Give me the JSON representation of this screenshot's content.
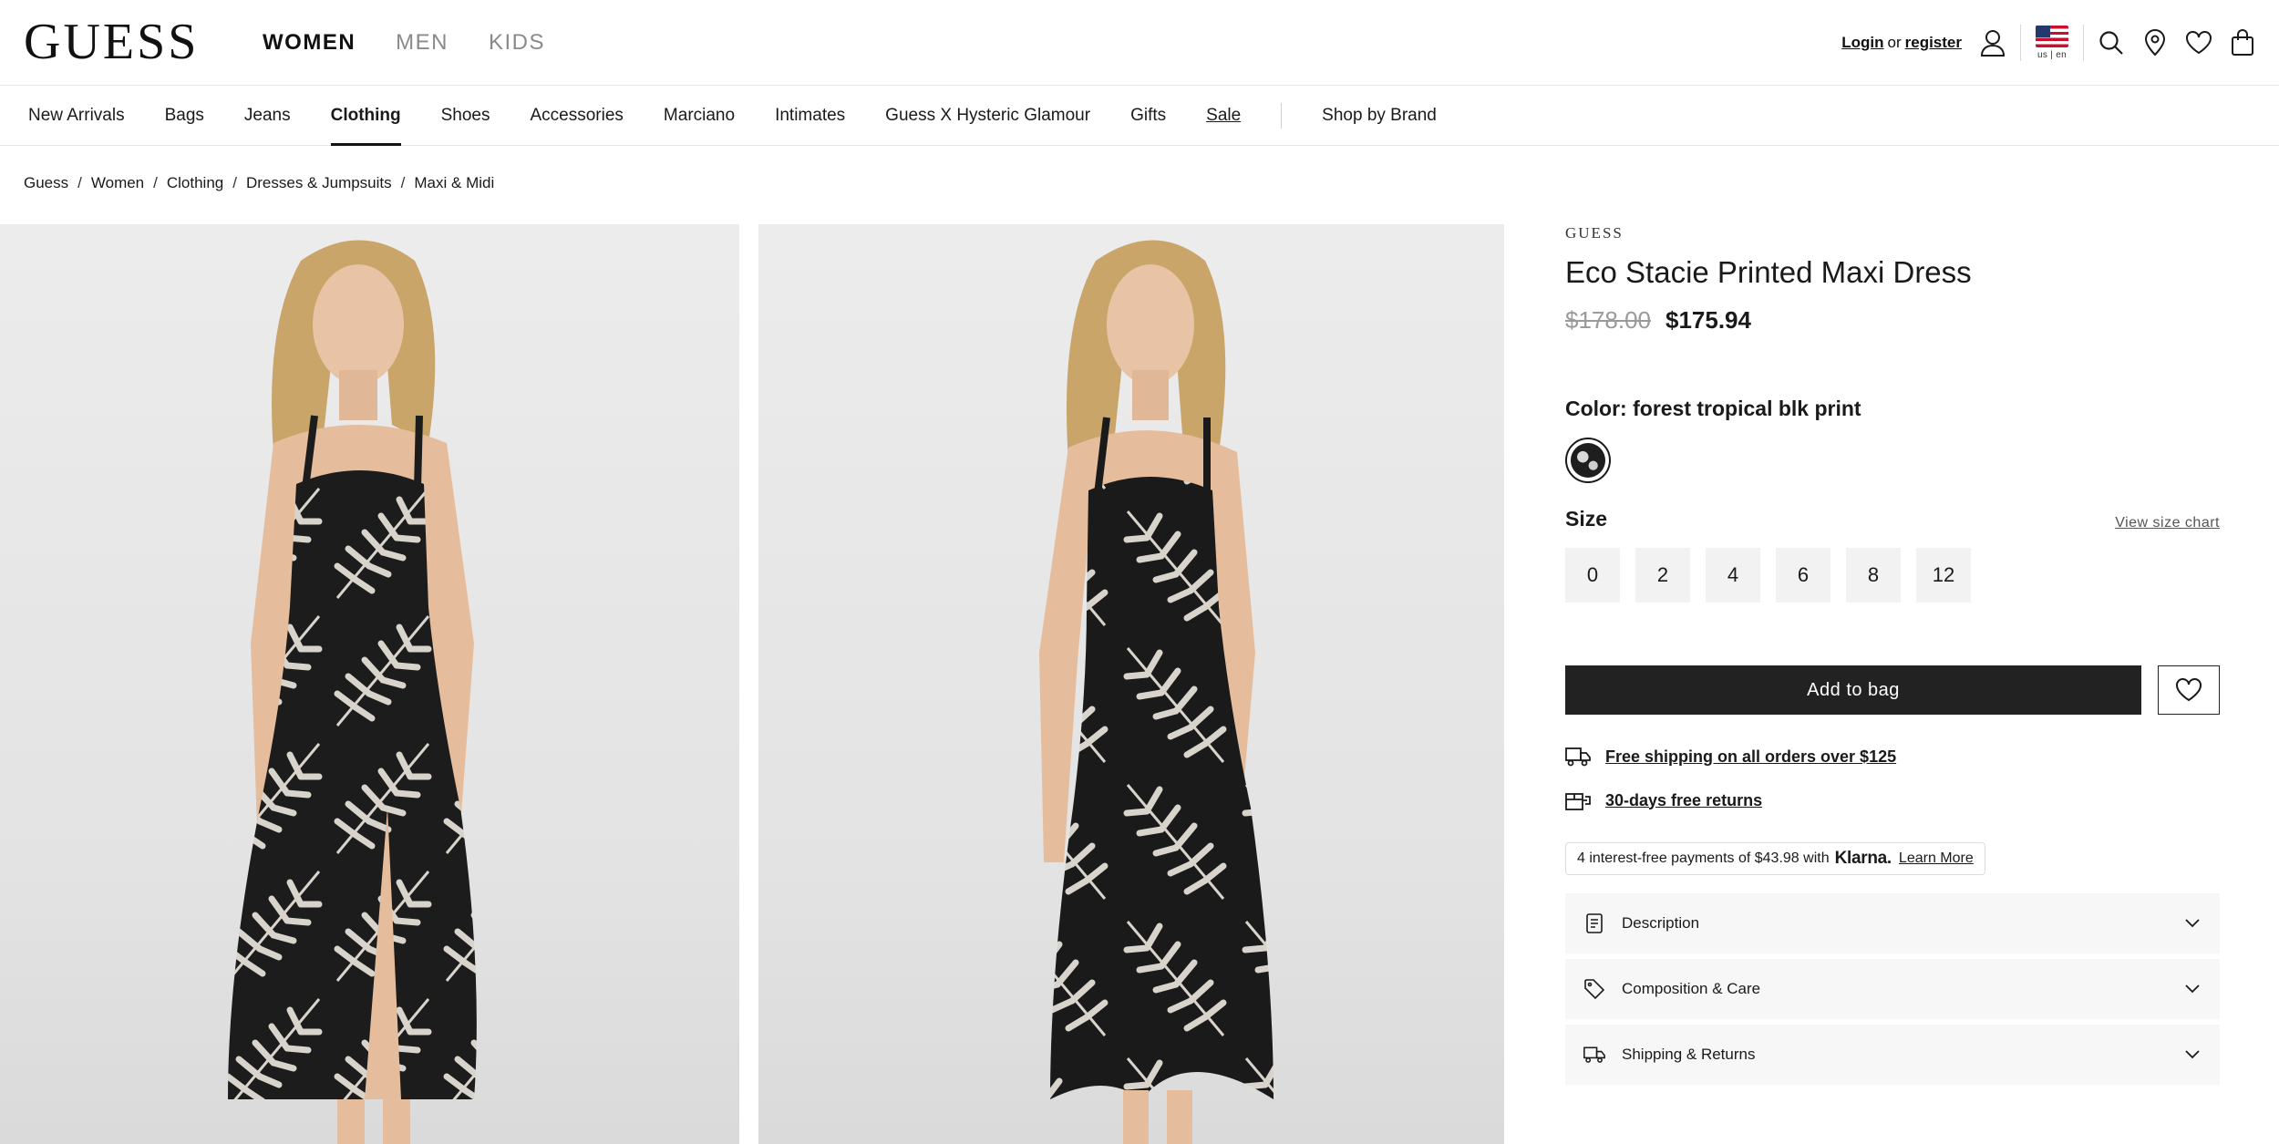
{
  "header": {
    "logo": "GUESS",
    "gender_tabs": [
      {
        "label": "WOMEN",
        "active": true
      },
      {
        "label": "MEN",
        "active": false
      },
      {
        "label": "KIDS",
        "active": false
      }
    ],
    "login": "Login",
    "or": "or",
    "register": "register",
    "locale": "us | en",
    "icons": [
      "user-icon",
      "flag-icon",
      "search-icon",
      "location-icon",
      "heart-icon",
      "bag-icon"
    ]
  },
  "category_nav": {
    "items": [
      "New Arrivals",
      "Bags",
      "Jeans",
      "Clothing",
      "Shoes",
      "Accessories",
      "Marciano",
      "Intimates",
      "Guess X Hysteric Glamour",
      "Gifts",
      "Sale"
    ],
    "active": "Clothing",
    "shop_by_brand": "Shop by Brand"
  },
  "breadcrumb": [
    "Guess",
    "Women",
    "Clothing",
    "Dresses & Jumpsuits",
    "Maxi & Midi"
  ],
  "product": {
    "brand": "GUESS",
    "title": "Eco Stacie Printed Maxi Dress",
    "price_original": "$178.00",
    "price_sale": "$175.94",
    "color_label": "Color:",
    "color_value": "forest tropical blk print",
    "size_label": "Size",
    "size_chart": "View size chart",
    "sizes": [
      "0",
      "2",
      "4",
      "6",
      "8",
      "12"
    ],
    "add_to_bag": "Add to bag",
    "perks": [
      "Free shipping on all orders over $125",
      "30-days free returns"
    ],
    "klarna": {
      "text": "4 interest-free payments of $43.98 with",
      "brand": "Klarna.",
      "learn_more": "Learn More"
    },
    "accordions": [
      "Description",
      "Composition & Care",
      "Shipping & Returns"
    ]
  },
  "colors": {
    "accent": "#222222",
    "muted": "#9a9a9a",
    "panel_bg": "#f7f7f7",
    "size_bg": "#f2f2f2"
  }
}
